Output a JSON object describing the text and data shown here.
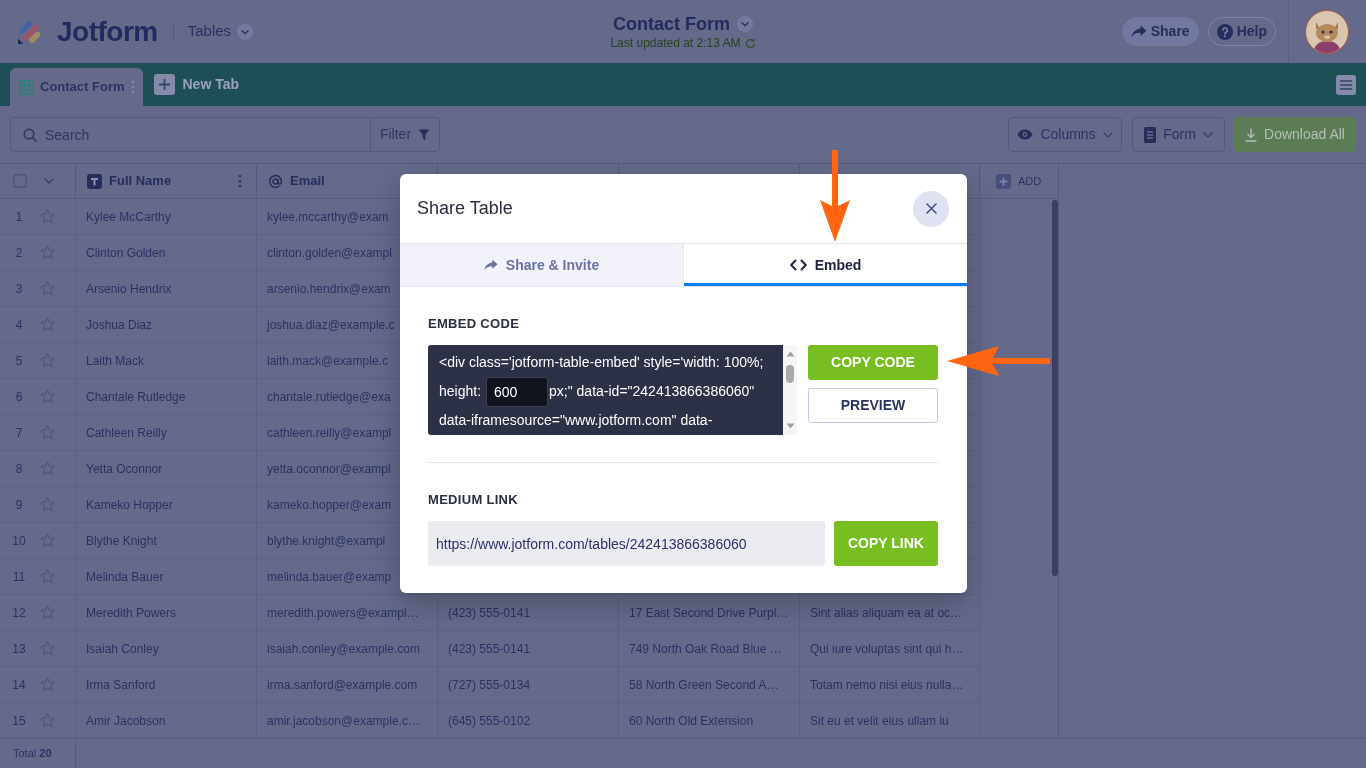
{
  "header": {
    "logo": "Jotform",
    "section": "Tables",
    "title": "Contact Form",
    "last_updated": "Last updated at 2:13 AM",
    "buttons": [
      {
        "label": "Share",
        "kind": "share"
      },
      {
        "label": "Help",
        "kind": "help"
      }
    ]
  },
  "sheet_tabs": [
    {
      "label": "Contact Form",
      "selected": true
    }
  ],
  "new_tab": "New Tab",
  "toolbar": {
    "search": {
      "placeholder": "Search"
    },
    "filter": "Filter",
    "buttons": [
      {
        "label": "Columns",
        "kind": "columns"
      },
      {
        "label": "Form",
        "kind": "form"
      },
      {
        "label": "Download All",
        "kind": "download"
      }
    ]
  },
  "table": {
    "select_all": {
      "checked": false
    },
    "columns": [
      {
        "label": "Full Name",
        "kind": "text"
      },
      {
        "label": "Email",
        "kind": "email"
      }
    ],
    "add_column": "ADD",
    "rows": [
      {
        "number": "1",
        "starred": false,
        "cells": [
          "Kylee McCarthy",
          "kylee.mccarthy@exam"
        ]
      },
      {
        "number": "2",
        "starred": false,
        "cells": [
          "Clinton Golden",
          "clinton.golden@exampl"
        ]
      },
      {
        "number": "3",
        "starred": false,
        "cells": [
          "Arsenio Hendrix",
          "arsenio.hendrix@exam"
        ]
      },
      {
        "number": "4",
        "starred": false,
        "cells": [
          "Joshua Diaz",
          "joshua.diaz@example.c"
        ]
      },
      {
        "number": "5",
        "starred": false,
        "cells": [
          "Laith Mack",
          "laith.mack@example.c"
        ]
      },
      {
        "number": "6",
        "starred": false,
        "cells": [
          "Chantale Rutledge",
          "chantale.rutledge@exa"
        ]
      },
      {
        "number": "7",
        "starred": false,
        "cells": [
          "Cathleen Reilly",
          "cathleen.reilly@exampl"
        ]
      },
      {
        "number": "8",
        "starred": false,
        "cells": [
          "Yetta Oconnor",
          "yetta.oconnor@exampl"
        ]
      },
      {
        "number": "9",
        "starred": false,
        "cells": [
          "Kameko Hopper",
          "kameko.hopper@exam"
        ]
      },
      {
        "number": "10",
        "starred": false,
        "cells": [
          "Blythe Knight",
          "blythe.knight@exampl"
        ]
      },
      {
        "number": "11",
        "starred": false,
        "cells": [
          "Melinda Bauer",
          "melinda.bauer@examp"
        ]
      },
      {
        "number": "12",
        "starred": false,
        "cells": [
          "Meredith Powers",
          "meredith.powers@exampl…",
          "(423) 555-0141",
          "17 East Second Drive Purpl…",
          "Sint alias aliquam ea at oc…"
        ]
      },
      {
        "number": "13",
        "starred": false,
        "cells": [
          "Isaiah Conley",
          "isaiah.conley@example.com",
          "(423) 555-0141",
          "749 North Oak Road Blue …",
          "Qui iure voluptas sint qui h…"
        ]
      },
      {
        "number": "14",
        "starred": false,
        "cells": [
          "Irma Sanford",
          "irma.sanford@example.com",
          "(727) 555-0134",
          "58 North Green Second A…",
          "Totam nemo nisi eius nulla…"
        ]
      },
      {
        "number": "15",
        "starred": false,
        "cells": [
          "Amir Jacobson",
          "amir.jacobson@example.c…",
          "(645) 555-0102",
          "60 North Old Extension",
          "Sit eu et velit eius ullam iu"
        ]
      }
    ],
    "footer": "Total **20**"
  },
  "modal": {
    "title": "Share Table",
    "tabs": [
      {
        "label": "Share & Invite",
        "kind": "share",
        "selected": false
      },
      {
        "label": "Embed",
        "kind": "embed",
        "selected": true
      }
    ],
    "embed_code": {
      "label": "EMBED CODE",
      "lines": [
        {
          "kind": "text",
          "text": "<div class='jotform-table-embed' style='width: 100%;"
        },
        {
          "kind": "field",
          "before": "height:",
          "value": "600",
          "after": "px;\" data-id=\"242413866386060\""
        },
        {
          "kind": "text",
          "text": "data-iframesource=\"www.jotform.com\" data-"
        }
      ],
      "buttons": [
        {
          "label": "COPY CODE",
          "kind": "primary"
        },
        {
          "label": "PREVIEW",
          "kind": "secondary"
        }
      ]
    },
    "medium_link": {
      "label": "MEDIUM LINK",
      "value": "https://www.jotform.com/tables/242413866386060",
      "button": "COPY LINK"
    }
  }
}
